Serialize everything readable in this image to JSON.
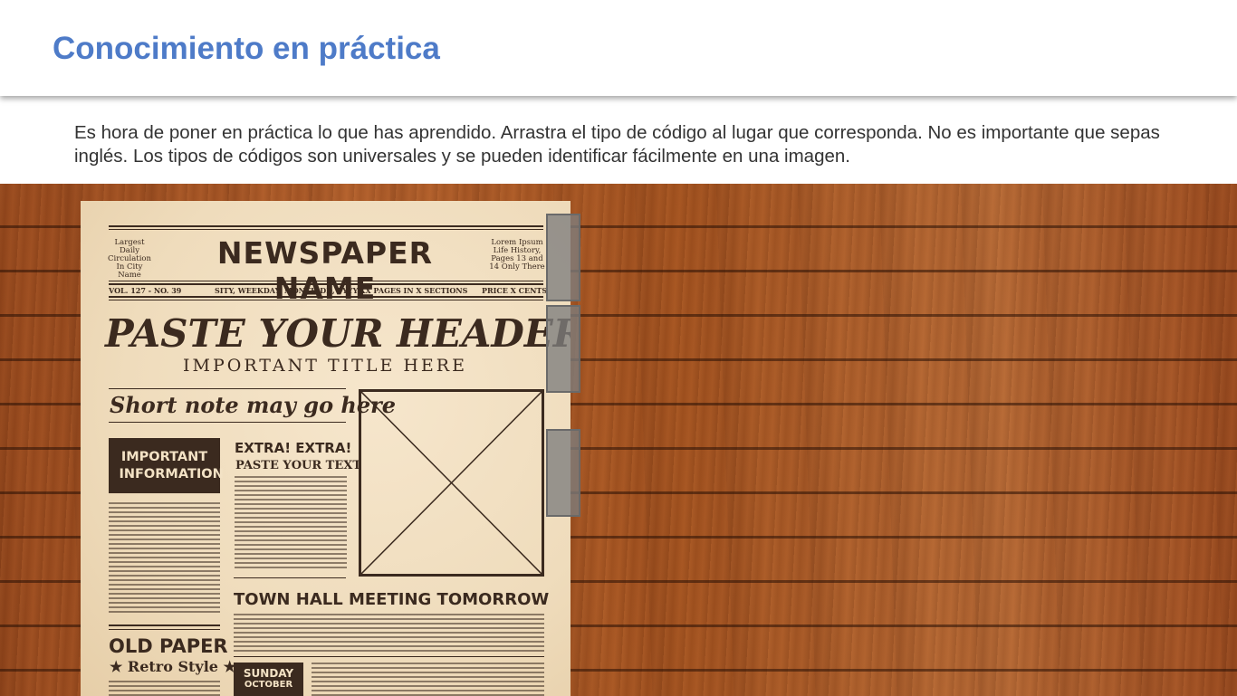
{
  "header": {
    "title": "Conocimiento en práctica"
  },
  "intro": "Es hora de poner en práctica lo que has aprendido. Arrastra el tipo de código al lugar que corresponda. No es importante que sepas inglés. Los tipos de códigos son universales y se pueden identificar fácilmente en una imagen.",
  "newspaper": {
    "left_ear": "Largest Daily Circulation In City Name",
    "masthead": "NEWSPAPER NAME",
    "right_ear": "Lorem Ipsum Life History, Pages 13 and 14 Only There",
    "volume": "VOL. 127 - NO. 39",
    "dateline": "SITY, WEEKDAY, MONTH DD, YYYY-XX PAGES IN X SECTIONS",
    "price": "PRICE X CENTS",
    "headline": "PASTE YOUR HEADER",
    "subheadline": "IMPORTANT TITLE HERE",
    "short_note": "Short note may go here",
    "important_box": "IMPORTANT INFORMATION",
    "extra": "EXTRA! EXTRA!",
    "paste_text": "PASTE YOUR TEXT",
    "town_hall": "TOWN HALL MEETING TOMORROW",
    "old_paper": "OLD PAPER",
    "retro_style": "★ Retro Style ★",
    "sunday": "SUNDAY",
    "october": "OCTOBER"
  },
  "drop_zones": [
    {
      "name": "drop-zone-1"
    },
    {
      "name": "drop-zone-2"
    },
    {
      "name": "drop-zone-3"
    }
  ],
  "colors": {
    "title": "#4e7bc8",
    "ink": "#3b2a1f",
    "paper": "#efdcbc",
    "drop_zone": "#7d7d7d"
  }
}
